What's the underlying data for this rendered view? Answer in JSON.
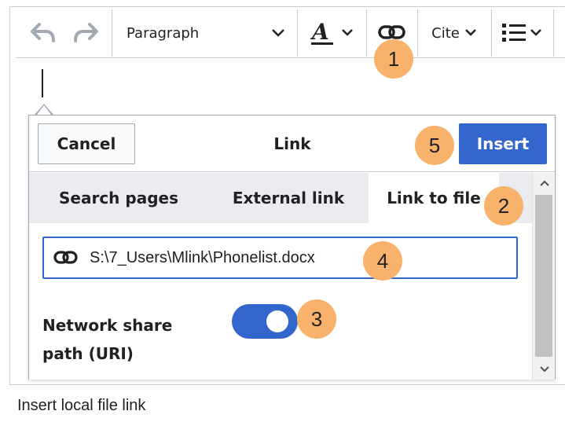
{
  "toolbar": {
    "undo_icon": "undo-icon",
    "redo_icon": "redo-icon",
    "paragraph_label": "Paragraph",
    "text_style_icon": "text-style-A-icon",
    "link_icon": "link-icon",
    "cite_label": "Cite",
    "list_icon": "list-icon"
  },
  "dialog": {
    "cancel_label": "Cancel",
    "title": "Link",
    "insert_label": "Insert",
    "tabs": [
      {
        "label": "Search pages",
        "active": false
      },
      {
        "label": "External link",
        "active": false
      },
      {
        "label": "Link to file",
        "active": true
      }
    ],
    "file_input_value": "S:\\7_Users\\Mlink\\Phonelist.docx",
    "toggle_label": "Network share path (URI)",
    "toggle_on": true
  },
  "callouts": [
    "1",
    "2",
    "3",
    "4",
    "5"
  ],
  "caption": "Insert local file link",
  "colors": {
    "accent": "#3366cc",
    "callout": "#f9b26b",
    "border": "#c8ccd1",
    "tab_bar": "#eaecf0"
  }
}
